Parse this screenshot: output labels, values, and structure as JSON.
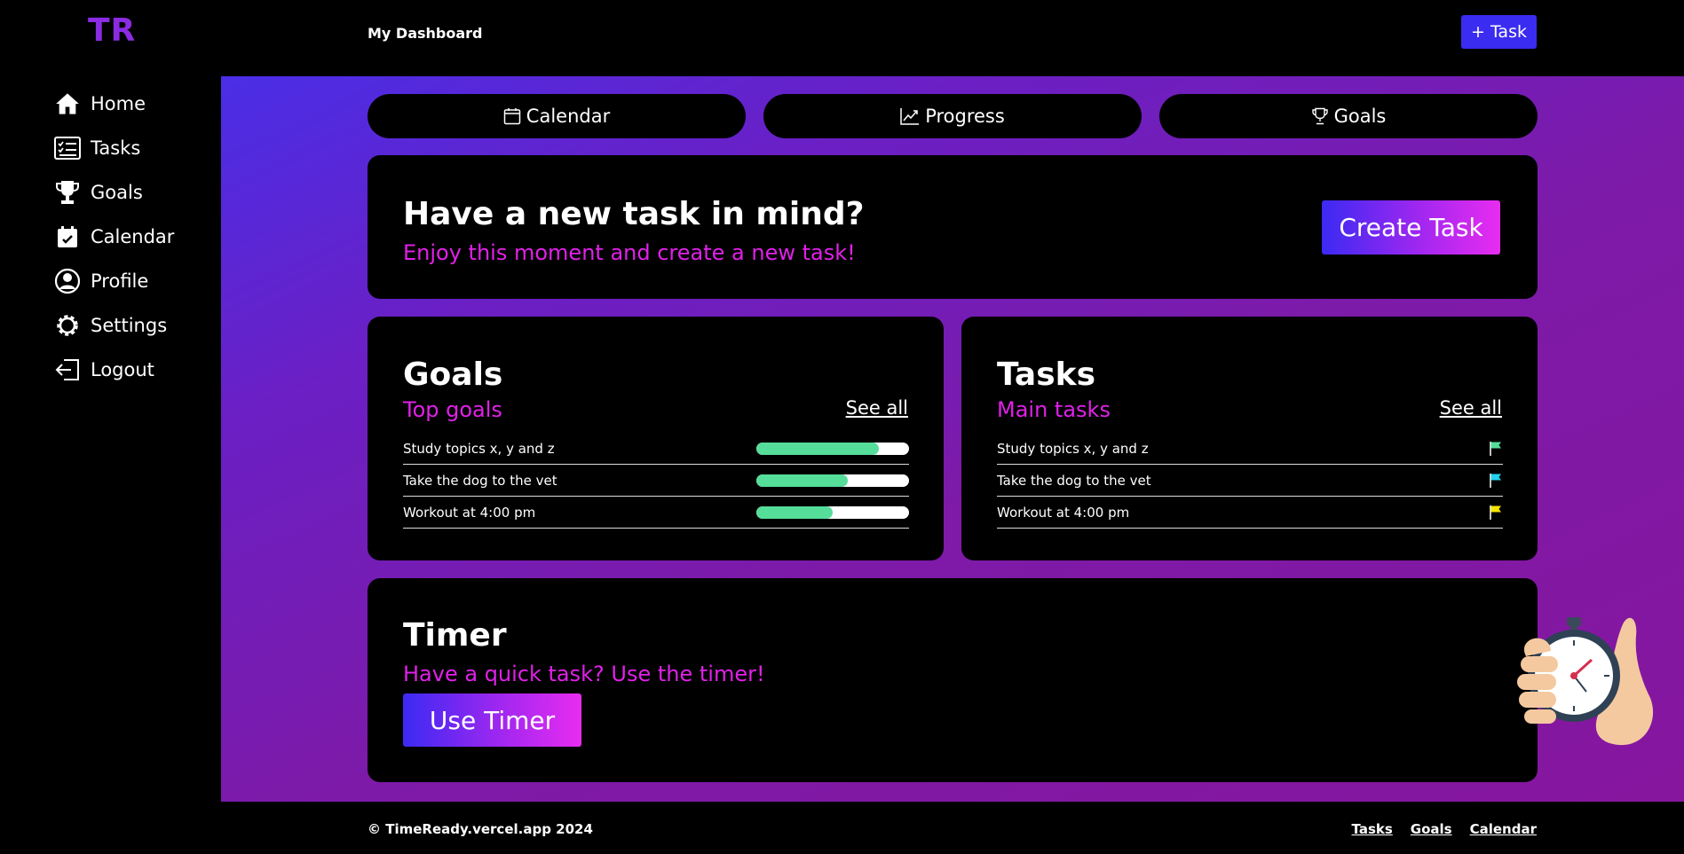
{
  "header": {
    "logo": "TR",
    "title": "My Dashboard",
    "new_task_label": "+ Task"
  },
  "sidebar": {
    "items": [
      {
        "label": "Home",
        "icon": "home-icon"
      },
      {
        "label": "Tasks",
        "icon": "checklist-icon"
      },
      {
        "label": "Goals",
        "icon": "trophy-icon"
      },
      {
        "label": "Calendar",
        "icon": "calendar-icon"
      },
      {
        "label": "Profile",
        "icon": "user-icon"
      },
      {
        "label": "Settings",
        "icon": "gear-icon"
      },
      {
        "label": "Logout",
        "icon": "logout-icon"
      }
    ]
  },
  "tabs": [
    {
      "label": "Calendar",
      "icon": "calendar-outline-icon"
    },
    {
      "label": "Progress",
      "icon": "chart-line-icon"
    },
    {
      "label": "Goals",
      "icon": "trophy-outline-icon"
    }
  ],
  "hero": {
    "title": "Have a new task in mind?",
    "subtitle": "Enjoy this moment and create a new task!",
    "button": "Create Task"
  },
  "goals": {
    "title": "Goals",
    "subtitle": "Top goals",
    "see_all": "See all",
    "items": [
      {
        "label": "Study topics x, y and z",
        "progress": 0.8
      },
      {
        "label": "Take the dog to the vet",
        "progress": 0.6
      },
      {
        "label": "Workout at 4:00 pm",
        "progress": 0.5
      }
    ]
  },
  "tasks": {
    "title": "Tasks",
    "subtitle": "Main tasks",
    "see_all": "See all",
    "items": [
      {
        "label": "Study topics x, y and z",
        "flag_color": "#55dd9a"
      },
      {
        "label": "Take the dog to the vet",
        "flag_color": "#22d3ee"
      },
      {
        "label": "Workout at 4:00 pm",
        "flag_color": "#f5e400"
      }
    ]
  },
  "timer": {
    "title": "Timer",
    "subtitle": "Have a quick task? Use the timer!",
    "button": "Use Timer"
  },
  "footer": {
    "copyright": "© TimeReady.vercel.app 2024",
    "links": [
      "Tasks",
      "Goals",
      "Calendar"
    ]
  },
  "colors": {
    "accent": "#e021e8",
    "primary": "#3a2cf0",
    "progress": "#55dd9a",
    "logo": "#8b2be2"
  }
}
